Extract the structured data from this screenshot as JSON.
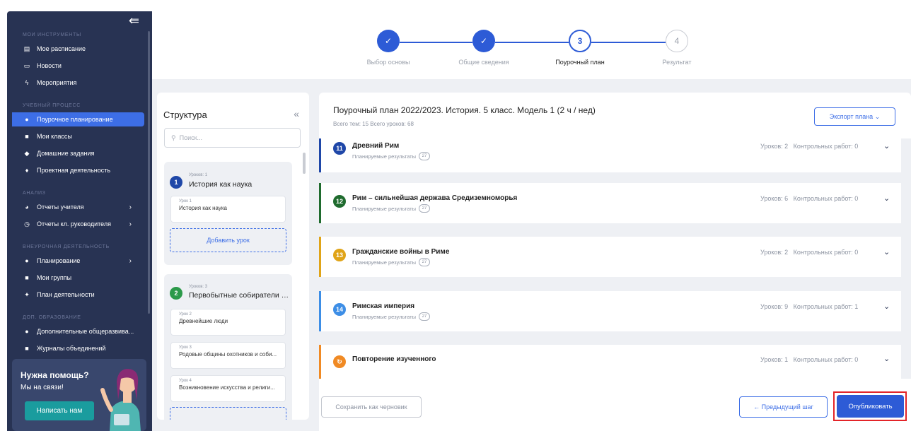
{
  "sidebar": {
    "sections": [
      {
        "label": "МОИ ИНСТРУМЕНТЫ"
      },
      {
        "label": "УЧЕБНЫЙ ПРОЦЕСС"
      },
      {
        "label": "АНАЛИЗ"
      },
      {
        "label": "ВНЕУРОЧНАЯ ДЕЯТЕЛЬНОСТЬ"
      },
      {
        "label": "ДОП. ОБРАЗОВАНИЕ"
      }
    ],
    "items": [
      {
        "label": "Мое расписание",
        "icon": "calendar-icon"
      },
      {
        "label": "Новости",
        "icon": "news-icon"
      },
      {
        "label": "Мероприятия",
        "icon": "bolt-icon"
      },
      {
        "label": "Поурочное планирование",
        "icon": "planning-icon"
      },
      {
        "label": "Мои классы",
        "icon": "classes-icon"
      },
      {
        "label": "Домашние задания",
        "icon": "homework-icon"
      },
      {
        "label": "Проектная деятельность",
        "icon": "project-icon"
      },
      {
        "label": "Отчеты учителя",
        "icon": "pie-chart-icon"
      },
      {
        "label": "Отчеты кл. руководителя",
        "icon": "clock-icon"
      },
      {
        "label": "Планирование",
        "icon": "planning-icon"
      },
      {
        "label": "Мои группы",
        "icon": "groups-icon"
      },
      {
        "label": "План деятельности",
        "icon": "activity-plan-icon"
      },
      {
        "label": "Дополнительные общеразвива...",
        "icon": "extra-education-icon"
      },
      {
        "label": "Журналы объединений",
        "icon": "journal-icon"
      }
    ],
    "help": {
      "title": "Нужна помощь?",
      "subtitle": "Мы на связи!",
      "button": "Написать нам"
    }
  },
  "stepper": {
    "steps": [
      {
        "label": "Выбор основы",
        "number": "1",
        "state": "done"
      },
      {
        "label": "Общие сведения",
        "number": "2",
        "state": "done"
      },
      {
        "label": "Поурочный план",
        "number": "3",
        "state": "current"
      },
      {
        "label": "Результат",
        "number": "4",
        "state": "pending"
      }
    ]
  },
  "structure": {
    "title": "Структура",
    "collapse": "«",
    "search_placeholder": "Поиск...",
    "topics": [
      {
        "number": "1",
        "sub": "Уроков: 1",
        "title": "История как наука",
        "color": "#1f47a8",
        "lessons": [
          {
            "num": "Урок 1",
            "title": "История как наука"
          }
        ],
        "add_label": "Добавить урок"
      },
      {
        "number": "2",
        "sub": "Уроков: 3",
        "title": "Первобытные собиратели и о...",
        "color": "#2c9a4a",
        "lessons": [
          {
            "num": "Урок 2",
            "title": "Древнейшие люди"
          },
          {
            "num": "Урок 3",
            "title": "Родовые общины охотников и соби..."
          },
          {
            "num": "Урок 4",
            "title": "Возникновение искусства и религи..."
          }
        ]
      }
    ]
  },
  "plan": {
    "title": "Поурочный план 2022/2023. История. 5 класс. Модель 1 (2 ч / нед)",
    "meta": "Всего тем: 15   Всего уроков: 68",
    "export_label": "Экспорт плана",
    "results_label": "Планируемые результаты",
    "topics": [
      {
        "number": "11",
        "title": "Древний Рим",
        "badge": "27",
        "lessons": "Уроков: 2",
        "control": "Контрольных работ: 0",
        "color": "#1f47a8"
      },
      {
        "number": "12",
        "title": "Рим – сильнейшая держава Средиземноморья",
        "badge": "27",
        "lessons": "Уроков: 6",
        "control": "Контрольных работ: 0",
        "color": "#1f6b2e"
      },
      {
        "number": "13",
        "title": "Гражданские войны в Риме",
        "badge": "27",
        "lessons": "Уроков: 2",
        "control": "Контрольных работ: 0",
        "color": "#e0a418"
      },
      {
        "number": "14",
        "title": "Римская империя",
        "badge": "27",
        "lessons": "Уроков: 9",
        "control": "Контрольных работ: 1",
        "color": "#3d8ee6"
      },
      {
        "number": "",
        "title": "Повторение изученного",
        "badge": "",
        "lessons": "Уроков: 1",
        "control": "Контрольных работ: 0",
        "color": "#f08a24"
      }
    ]
  },
  "footer": {
    "draft_label": "Сохранить как черновик",
    "prev_label": "← Предыдущий шаг",
    "publish_label": "Опубликовать"
  },
  "colors": {
    "accent": "#2d5bd6",
    "sidebar": "#283353",
    "highlight": "#e32429"
  }
}
